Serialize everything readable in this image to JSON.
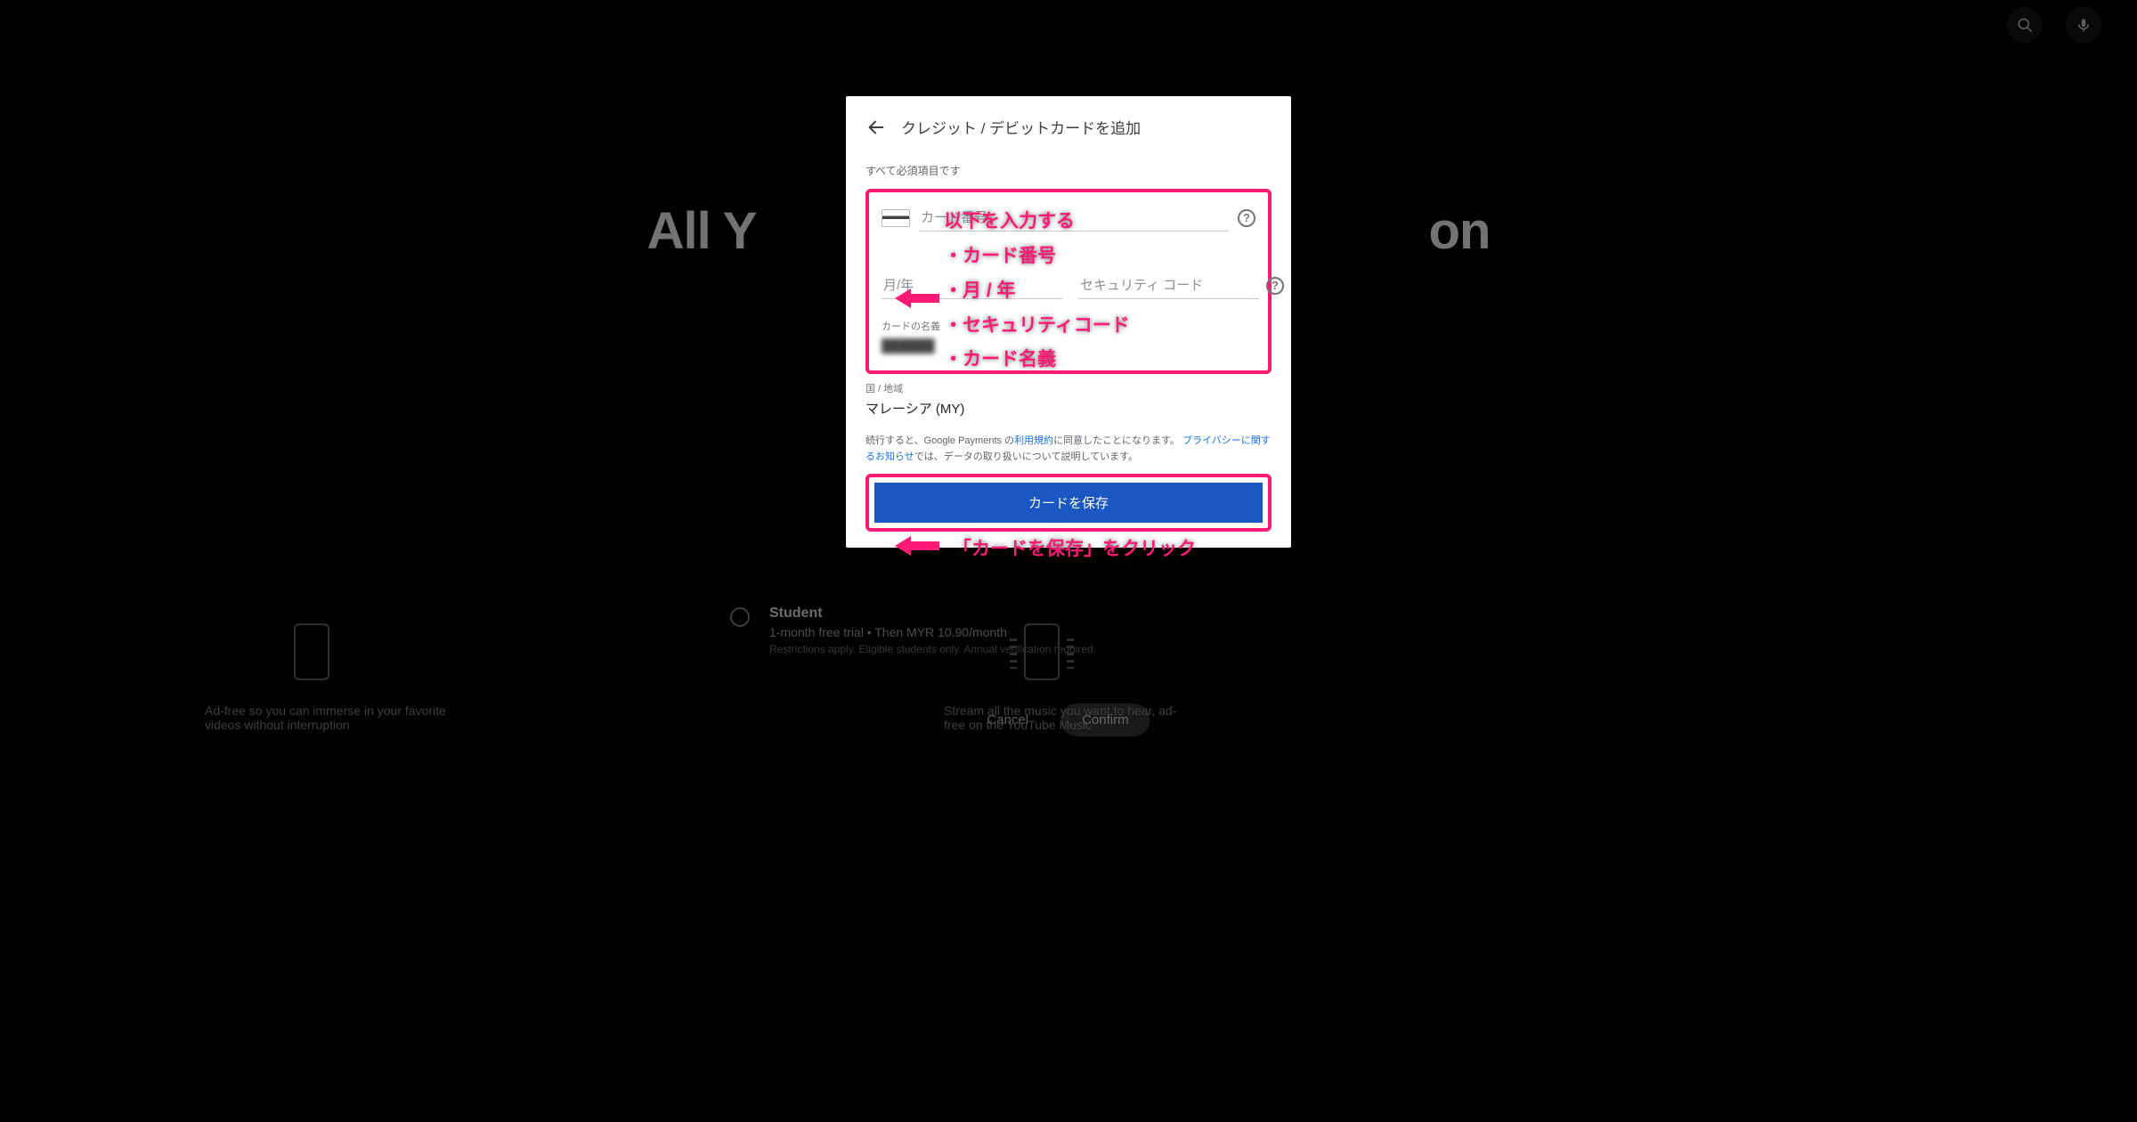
{
  "bg": {
    "hero_partial_left": "All Y",
    "hero_partial_right": "on",
    "plan": {
      "name": "Student",
      "subtitle": "1-month free trial • Then MYR 10.90/month",
      "note": "Restrictions apply. Eligible students only. Annual verification required."
    },
    "cancel": "Cancel",
    "confirm": "Confirm",
    "feature_left": "Ad-free so you can immerse in your favorite videos without interruption",
    "feature_right": "Stream all the music you want to hear, ad-free on the YouTube Music"
  },
  "modal": {
    "title": "クレジット / デビットカードを追加",
    "subtitle": "すべて必須項目です",
    "card_number_placeholder": "カード番号",
    "expiry_placeholder": "月/年",
    "cvc_placeholder": "セキュリティ コード",
    "name_label": "カードの名義",
    "name_value": "██████",
    "region_label": "国 / 地域",
    "region_value": "マレーシア (MY)",
    "legal_pre": "続行すると、Google Payments の",
    "legal_tos": "利用規約",
    "legal_mid": "に同意したことになります。",
    "legal_privacy": "プライバシーに関するお知らせ",
    "legal_post": "では、データの取り扱いについて説明しています。",
    "save": "カードを保存",
    "help": "?"
  },
  "annot": {
    "top_title": "以下を入力する",
    "top_items": [
      "・カード番号",
      "・月 / 年",
      "・セキュリティコード",
      "・カード名義"
    ],
    "bottom": "「カードを保存」をクリック"
  }
}
